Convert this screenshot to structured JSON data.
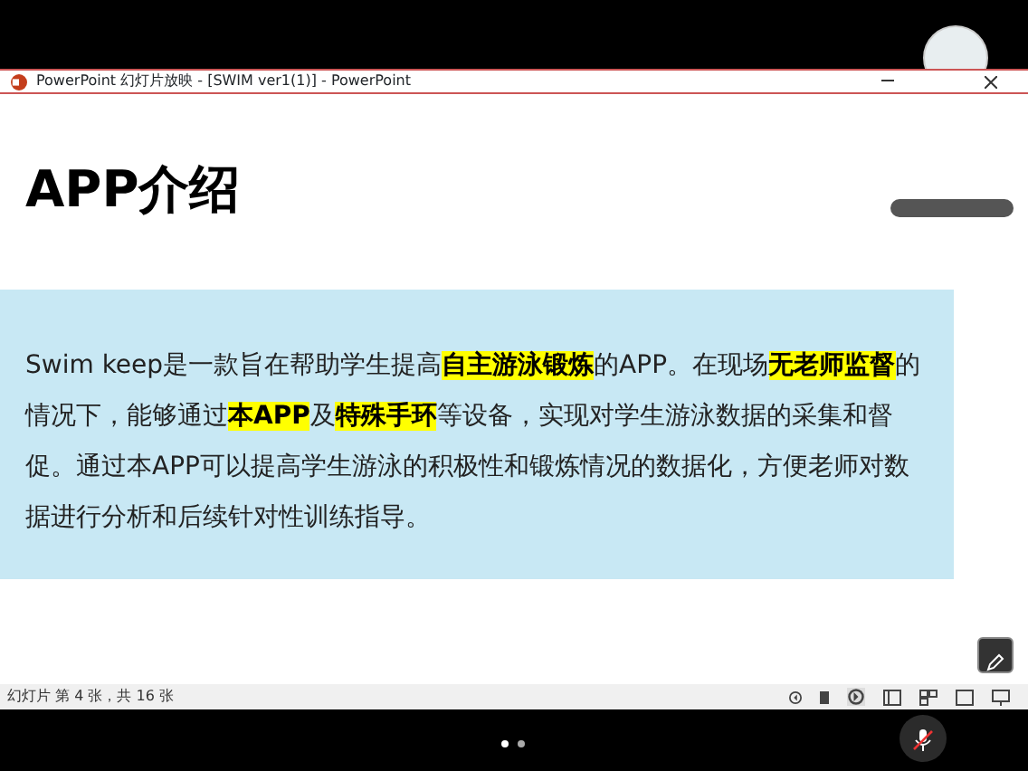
{
  "window": {
    "title": "PowerPoint 幻灯片放映 - [SWIM ver1(1)] - PowerPoint"
  },
  "slide": {
    "heading": "APP介绍",
    "paragraph": [
      {
        "text": "Swim keep是一款旨在帮助学生提高",
        "highlight": false
      },
      {
        "text": "自主游泳锻炼",
        "highlight": true
      },
      {
        "text": "的APP。在现场",
        "highlight": false
      },
      {
        "text": "无老师监督",
        "highlight": true
      },
      {
        "text": "的情况下，能够通过",
        "highlight": false
      },
      {
        "text": "本APP",
        "highlight": true
      },
      {
        "text": "及",
        "highlight": false
      },
      {
        "text": "特殊手环",
        "highlight": true
      },
      {
        "text": "等设备，实现对学生游泳数据的采集和督促。通过本APP可以提高学生游泳的积极性和锻炼情况的数据化，方便老师对数据进行分析和后续针对性训练指导。",
        "highlight": false
      }
    ]
  },
  "status_bar": {
    "slide_counter": "幻灯片 第 4 张，共 16 张"
  },
  "mic": {
    "muted": true
  }
}
